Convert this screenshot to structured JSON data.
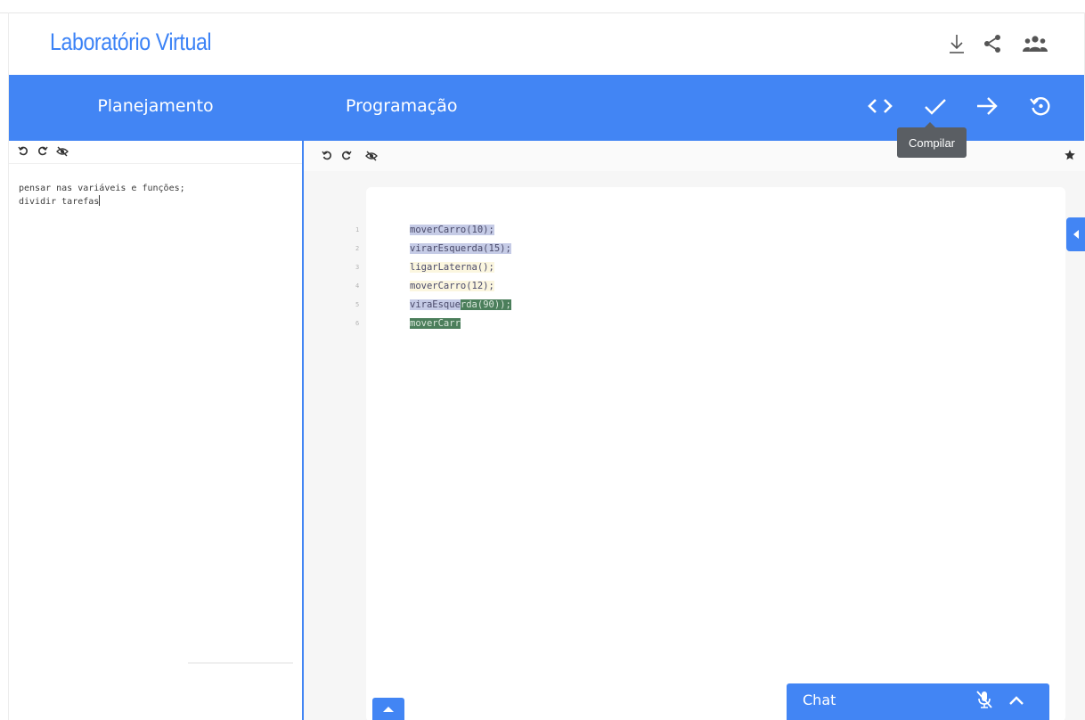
{
  "app": {
    "title": "Laboratório Virtual"
  },
  "header_icons": [
    "download-icon",
    "share-icon",
    "group-icon"
  ],
  "planning": {
    "title": "Planejamento",
    "toolbar": [
      "undo-icon",
      "redo-icon",
      "visibility-off-icon"
    ],
    "notes": [
      "pensar nas variáveis e funções;",
      "dividir tarefas"
    ]
  },
  "programming": {
    "title": "Programação",
    "actions": [
      "code-icon",
      "check-icon",
      "arrow-right-icon",
      "history-icon"
    ],
    "tooltip": "Compilar",
    "toolbar": [
      "undo-icon",
      "redo-icon",
      "visibility-off-icon",
      "star-icon"
    ],
    "code": {
      "lines": [
        {
          "number": "1",
          "segments": [
            {
              "text": "moverCarro(10);",
              "style": "blue"
            }
          ]
        },
        {
          "number": "2",
          "segments": [
            {
              "text": "virarEsquerda(15);",
              "style": "blue"
            }
          ]
        },
        {
          "number": "3",
          "segments": [
            {
              "text": "ligarLaterna();",
              "style": "yellow"
            }
          ]
        },
        {
          "number": "4",
          "segments": [
            {
              "text": "moverCarro(12);",
              "style": "yellow"
            }
          ]
        },
        {
          "number": "5",
          "segments": [
            {
              "text": "viraEsque",
              "style": "blue"
            },
            {
              "text": "rda(90)",
              "style": "green"
            },
            {
              "text": ");",
              "style": "green"
            }
          ]
        },
        {
          "number": "6",
          "segments": [
            {
              "text": "moverCarr",
              "style": "green"
            }
          ]
        }
      ]
    }
  },
  "chat": {
    "label": "Chat",
    "icons": [
      "mic-off-icon",
      "chevron-up-icon"
    ]
  },
  "colors": {
    "primary": "#4285f4",
    "title": "#3b82f6",
    "highlight_blue": "#c5cbe6",
    "highlight_yellow": "#fbf6df",
    "highlight_green": "#4b7e5b"
  }
}
